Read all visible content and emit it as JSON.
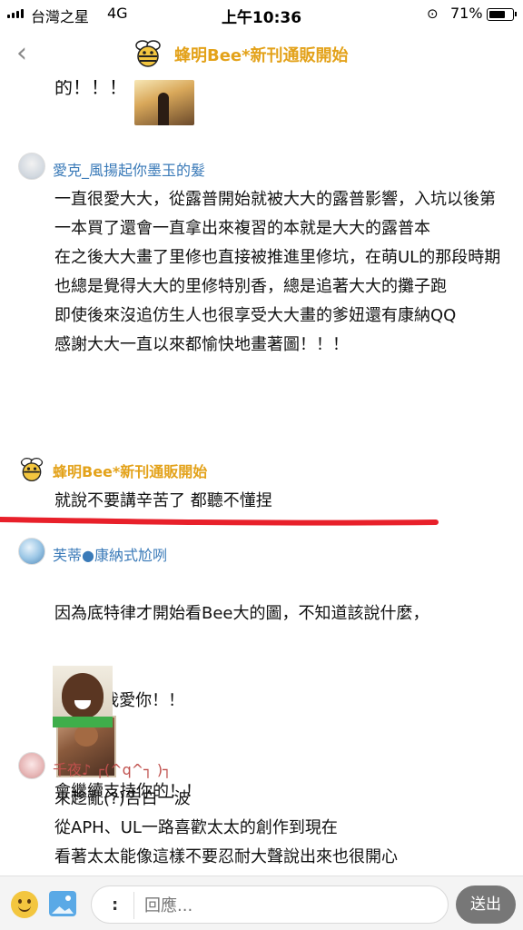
{
  "status_bar": {
    "carrier": "台灣之星",
    "network": "4G",
    "time": "上午10:36",
    "battery": "71%",
    "battery_level": 0.71
  },
  "nav": {
    "title": "蜂明Bee*新刊通販開始"
  },
  "cut_text": "的！！！",
  "comments": [
    {
      "name": "愛克_風揚起你墨玉的髮",
      "body": "一直很愛大大，從露普開始就被大大的露普影響，入坑以後第一本買了還會一直拿出來複習的本就是大大的露普本\n在之後大大畫了里修也直接被推進里修坑，在萌UL的那段時期也總是覺得大大的里修特別香，總是追著大大的攤子跑\n即使後來沒追仿生人也很享受大大畫的爹妞還有康納QQ\n感謝大大一直以來都愉快地畫著圖！！！"
    },
    {
      "name": "蜂明Bee*新刊通販開始",
      "body": "就說不要講辛苦了 都聽不懂捏"
    },
    {
      "name": "芙蒂●康納式尬咧",
      "body_line1": "因為底特律才開始看Bee大的圖，不知道該說什麼，",
      "body_line2a": "只好...我愛你！！",
      "body_line2b": "會繼續支持你的！！"
    },
    {
      "name": "千夜♪ ┌(^q^┐ )┐",
      "body": "來趁亂(?)告白一波\n從APH、UL一路喜歡太太的創作到現在\n看著太太能像這樣不要忍耐大聲說出來也很開心\n從今以後⋯⋯樣支持您❤️"
    }
  ],
  "input": {
    "kaomoji": ":",
    "placeholder": "回應...",
    "send_label": "送出"
  },
  "colors": {
    "accent": "#e3a21a",
    "username": "#3a7ab8",
    "red_line": "#e8202a"
  }
}
